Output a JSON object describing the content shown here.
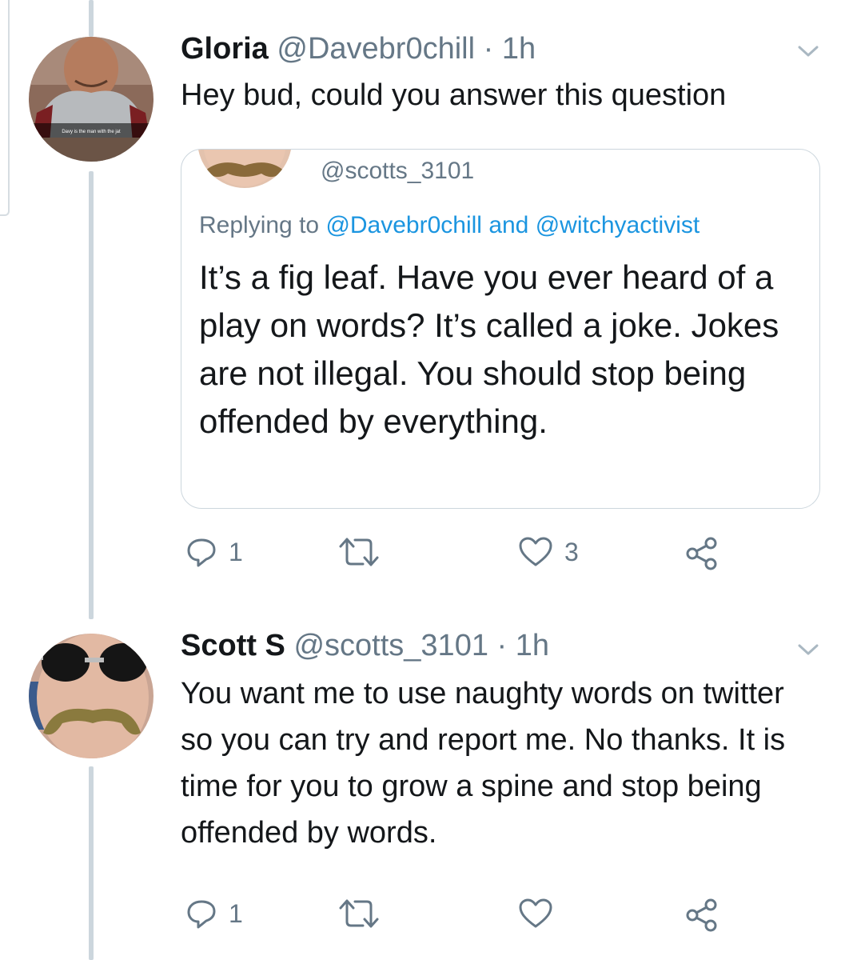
{
  "tweet1": {
    "name": "Gloria",
    "handle": "@Davebr0chill",
    "separator": "·",
    "time": "1h",
    "text": "Hey bud, could you answer this question",
    "avatar_caption": "Davy is the man with the jat",
    "quoted": {
      "handle": "@scotts_3101",
      "replying_prefix": "Replying to",
      "reply_to_1": "@Davebr0chill",
      "reply_joiner": "and",
      "reply_to_2": "@witchyactivist",
      "text": "It’s a fig leaf. Have you ever heard of a play on words? It’s called a joke. Jokes are not illegal. You should stop being offended by everything."
    },
    "actions": {
      "reply_count": "1",
      "retweet_count": "",
      "like_count": "3"
    }
  },
  "tweet2": {
    "name": "Scott S",
    "handle": "@scotts_3101",
    "separator": "·",
    "time": "1h",
    "text": "You want me to use naughty words on twitter so you can try and report me. No thanks. It is time for you to grow a spine and stop being offended by words.",
    "actions": {
      "reply_count": "1",
      "retweet_count": "",
      "like_count": ""
    }
  },
  "icons": [
    "reply-icon",
    "retweet-icon",
    "like-icon",
    "share-icon",
    "chevron-down-icon"
  ],
  "colors": {
    "text": "#14171a",
    "secondary": "#657786",
    "link": "#1b95e0",
    "thread_line": "#ccd6dd",
    "border": "#ccd6dd"
  }
}
